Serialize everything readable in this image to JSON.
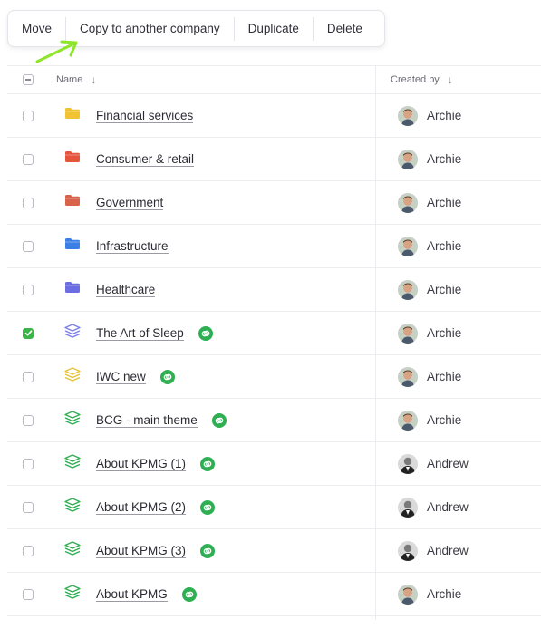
{
  "toolbar": {
    "actions": [
      "Move",
      "Copy to another company",
      "Duplicate",
      "Delete"
    ]
  },
  "table": {
    "columns": {
      "name": "Name",
      "created_by": "Created by"
    },
    "rows": [
      {
        "name": "Financial services",
        "type": "folder",
        "color": "#f1c232",
        "checked": false,
        "linked": false,
        "creator": "Archie"
      },
      {
        "name": "Consumer & retail",
        "type": "folder",
        "color": "#e4553b",
        "checked": false,
        "linked": false,
        "creator": "Archie"
      },
      {
        "name": "Government",
        "type": "folder",
        "color": "#d9624a",
        "checked": false,
        "linked": false,
        "creator": "Archie"
      },
      {
        "name": "Infrastructure",
        "type": "folder",
        "color": "#3b7fe6",
        "checked": false,
        "linked": false,
        "creator": "Archie"
      },
      {
        "name": "Healthcare",
        "type": "folder",
        "color": "#6a6ee2",
        "checked": false,
        "linked": false,
        "creator": "Archie"
      },
      {
        "name": "The Art of Sleep",
        "type": "stack",
        "color": "#7b7fe8",
        "checked": true,
        "linked": true,
        "creator": "Archie"
      },
      {
        "name": "IWC new",
        "type": "stack",
        "color": "#e8c13a",
        "checked": false,
        "linked": true,
        "creator": "Archie"
      },
      {
        "name": "BCG - main theme",
        "type": "stack",
        "color": "#2eaf52",
        "checked": false,
        "linked": true,
        "creator": "Archie"
      },
      {
        "name": "About KPMG (1)",
        "type": "stack",
        "color": "#2eaf52",
        "checked": false,
        "linked": true,
        "creator": "Andrew"
      },
      {
        "name": "About KPMG (2)",
        "type": "stack",
        "color": "#2eaf52",
        "checked": false,
        "linked": true,
        "creator": "Andrew"
      },
      {
        "name": "About KPMG (3)",
        "type": "stack",
        "color": "#2eaf52",
        "checked": false,
        "linked": true,
        "creator": "Andrew"
      },
      {
        "name": "About KPMG",
        "type": "stack",
        "color": "#2eaf52",
        "checked": false,
        "linked": true,
        "creator": "Archie"
      }
    ]
  },
  "colors": {
    "accent_green": "#2eaf52",
    "arrow_green": "#8ee62a"
  }
}
